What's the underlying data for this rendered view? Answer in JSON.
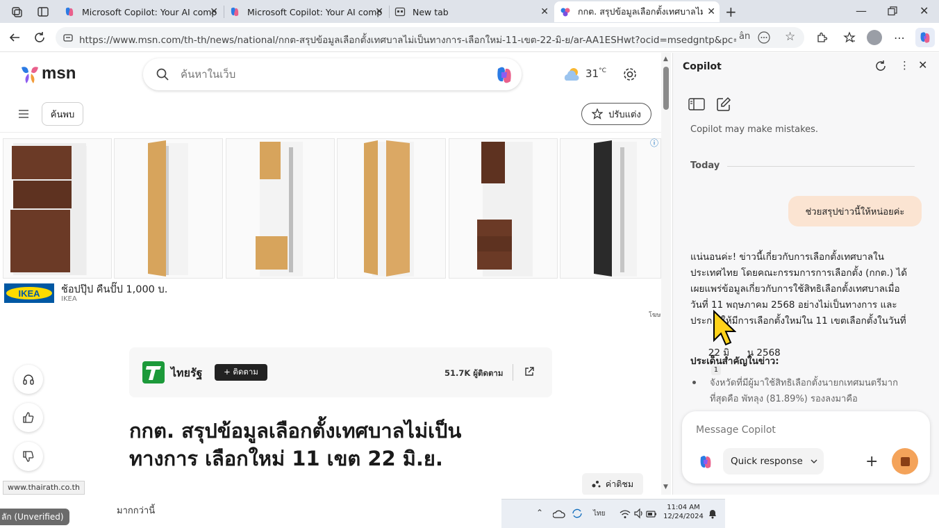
{
  "tabs": [
    {
      "title": "Microsoft Copilot: Your AI compa",
      "active": false
    },
    {
      "title": "Microsoft Copilot: Your AI compa",
      "active": false
    },
    {
      "title": "New tab",
      "active": false
    },
    {
      "title": "กกต. สรุปข้อมูลเลือกตั้งเทศบาลไม่เป็นท",
      "active": true
    }
  ],
  "address": {
    "url": "https://www.msn.com/th-th/news/national/กกต-สรุปข้อมูลเลือกตั้งเทศบาลไม่เป็นทางการ-เลือกใหม่-11-เขต-22-มิ-ย/ar-AA1ESHwt?ocid=msedgntp&pc=ASTS&c...",
    "read_aloud": "ân"
  },
  "msn": {
    "logo_text": "msn",
    "search_placeholder": "ค้นหาในเว็บ",
    "weather_temp": "31",
    "weather_unit": "°C",
    "discover_label": "ค้นพบ",
    "customize_label": "ปรับแต่ง",
    "ad": {
      "brand_logo": "IKEA",
      "headline": "ช้อปปุ๊ป คืนปั๊ป 1,000 บ.",
      "source": "IKEA",
      "sponsored": "โฆษ",
      "info": "ⓘ"
    },
    "publisher": {
      "name": "ไทยรัฐ",
      "follow_label": "+ ติดตาม",
      "followers": "51.7K ผู้ติดตาม"
    },
    "article_title_line1": "กกต. สรุปข้อมูลเลือกตั้งเทศบาลไม่เป็น",
    "article_title_line2": "ทางการ เลือกใหม่ 11 เขต 22 มิ.ย.",
    "comments_label": "ค่าติชม",
    "status_url": "www.thairath.co.th",
    "bottom_text": "มากกว่านี้",
    "unverified": "ลัก (Unverified)"
  },
  "copilot": {
    "title": "Copilot",
    "disclaimer": "Copilot may make mistakes.",
    "today": "Today",
    "user_message": "ช่วยสรุปข่าวนี้ให้หน่อยค่ะ",
    "reply_lines": [
      "แน่นอนค่ะ! ข่าวนี้เกี่ยวกับการเลือกตั้งเทศบาลใน",
      "ประเทศไทย โดยคณะกรรมการการเลือกตั้ง (กกต.) ได้",
      "เผยแพร่ข้อมูลเกี่ยวกับการใช้สิทธิเลือกตั้งเทศบาลเมื่อ",
      "วันที่ 11 พฤษภาคม 2568 อย่างไม่เป็นทางการ และ",
      "ประก   ให้มีการเลือกตั้งใหม่ใน 11 เขตเลือกตั้งในวันที่",
      "22 มิ      น 2568"
    ],
    "citation": "1",
    "key_points_heading": "ประเด็นสำคัญในข่าว:",
    "bullet_line1": "จังหวัดที่มีผู้มาใช้สิทธิเลือกตั้งนายกเทศมนตรีมาก",
    "bullet_line2": "ที่สุดคือ พัทลุง (81.89%) รองลงมาคือ",
    "input_placeholder": "Message Copilot",
    "mode_label": "Quick response"
  },
  "taskbar": {
    "lang": "ไทย",
    "time": "11:04 AM",
    "date": "12/24/2024"
  },
  "colors": {
    "accent": "#0f6cbd",
    "user_bubble": "#fbe4d2",
    "stop_button": "#f4a35a",
    "thairath_green": "#1c9a3a"
  }
}
